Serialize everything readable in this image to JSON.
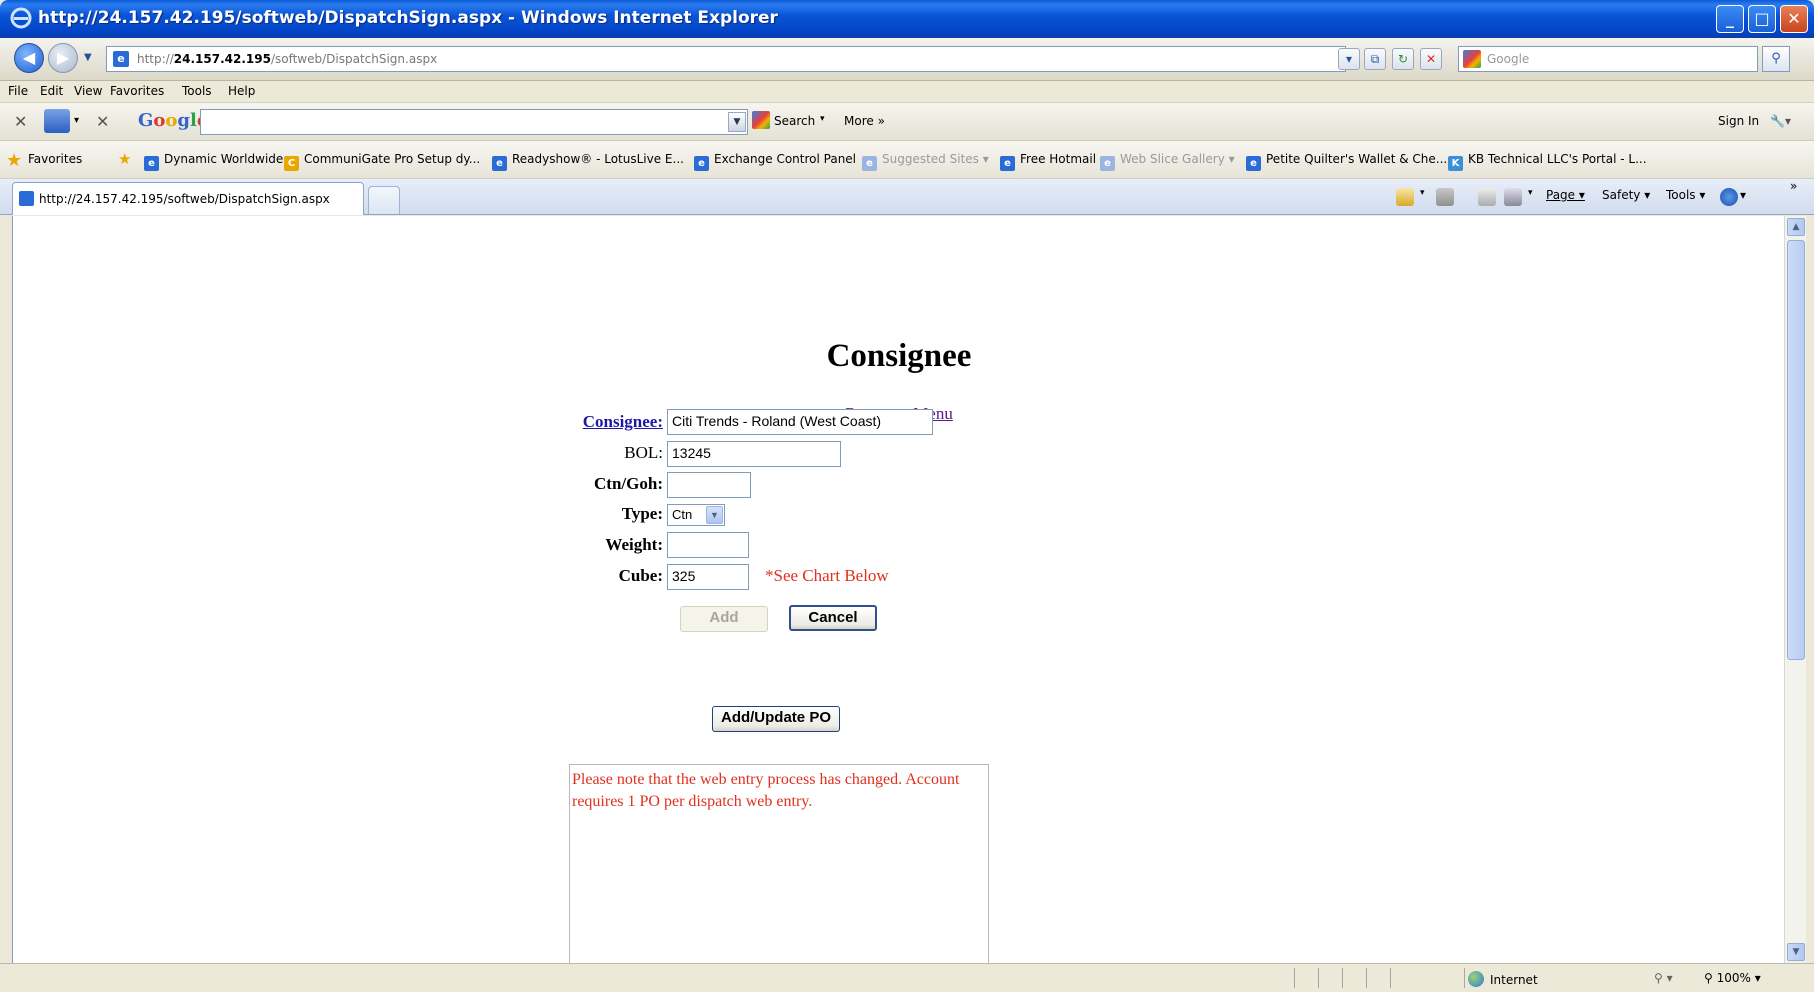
{
  "window": {
    "title": "http://24.157.42.195/softweb/DispatchSign.aspx - Windows Internet Explorer",
    "min": "_",
    "max": "□",
    "close": "✕"
  },
  "address": {
    "url_prefix": "http://",
    "url_host": "24.157.42.195",
    "url_path": "/softweb/DispatchSign.aspx",
    "search_placeholder": "Google"
  },
  "menu": [
    "File",
    "Edit",
    "View",
    "Favorites",
    "Tools",
    "Help"
  ],
  "google_toolbar": {
    "logo_g1": "G",
    "logo_o1": "o",
    "logo_o2": "o",
    "logo_g2": "g",
    "logo_l": "l",
    "logo_e": "e",
    "search_label": "Search",
    "more_label": "More »",
    "sign_in": "Sign In"
  },
  "favorites": {
    "label": "Favorites",
    "items": [
      "Dynamic Worldwide",
      "CommuniGate Pro Setup dy...",
      "Readyshow® - LotusLive E...",
      "Exchange Control Panel",
      "Suggested Sites ▾",
      "Free Hotmail",
      "Web Slice Gallery ▾",
      "Petite Quilter's Wallet & Che...",
      "KB Technical LLC's Portal - L..."
    ]
  },
  "tab": {
    "title": "http://24.157.42.195/softweb/DispatchSign.aspx"
  },
  "commands": {
    "page": "Page ▾",
    "safety": "Safety ▾",
    "tools": "Tools ▾",
    "help": "▾"
  },
  "page": {
    "title": "Consignee",
    "return_link": "Return to Menu",
    "fields": {
      "consignee_label": "Consignee:",
      "consignee_value": "Citi Trends - Roland (West Coast)",
      "bol_label": "BOL:",
      "bol_value": "13245",
      "ctn_goh_label": "Ctn/Goh:",
      "ctn_goh_value": "",
      "type_label": "Type:",
      "type_value": "Ctn",
      "weight_label": "Weight:",
      "weight_value": "",
      "cube_label": "Cube:",
      "cube_value": "325",
      "cube_note": "*See Chart Below"
    },
    "buttons": {
      "add": "Add",
      "cancel": "Cancel",
      "add_update_po": "Add/Update PO"
    },
    "notice": "Please note that the web entry process has changed. Account requires 1 PO per dispatch web entry."
  },
  "status": {
    "zone": "Internet",
    "zoom": "100%"
  }
}
